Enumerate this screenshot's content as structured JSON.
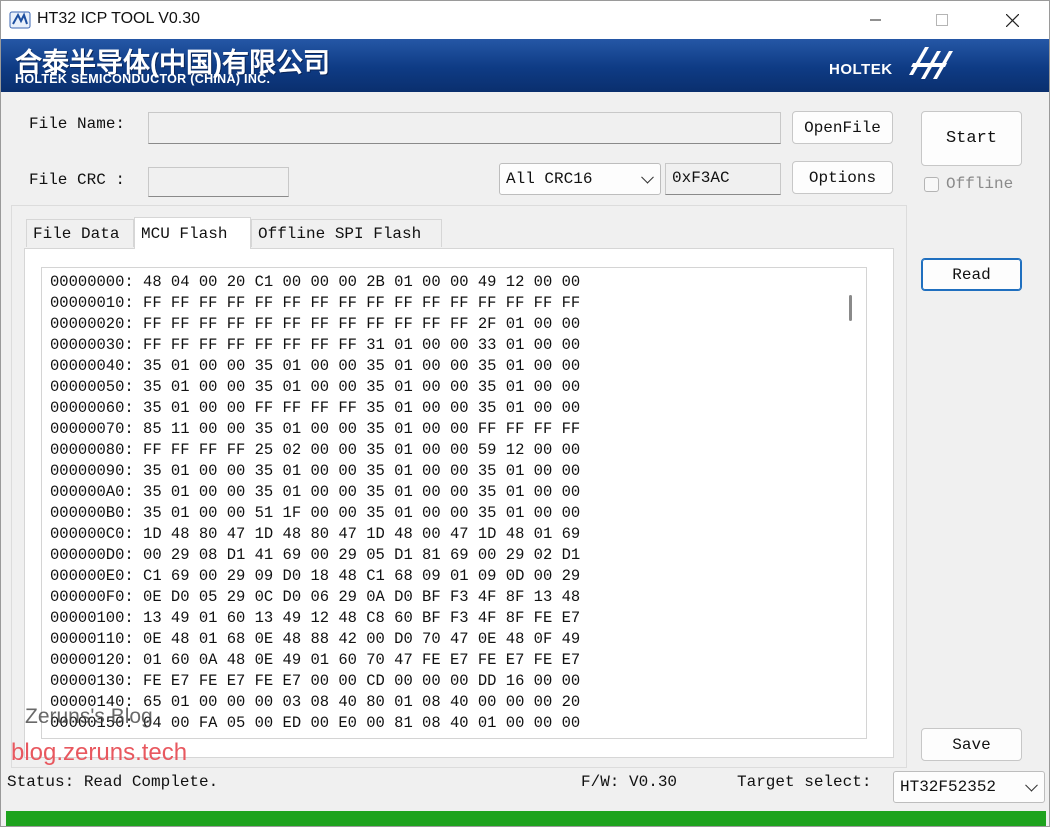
{
  "window": {
    "title": "HT32 ICP TOOL V0.30",
    "minimize_glyph": "—",
    "maximize_glyph": "☐",
    "close_glyph": "✕"
  },
  "banner": {
    "company_cn": "合泰半导体(中国)有限公司",
    "company_en": "HOLTEK SEMICONDUCTOR (CHINA) INC.",
    "brand": "HOLTEK"
  },
  "form": {
    "file_name_label": "File Name:",
    "file_name_value": "",
    "file_crc_label": "File CRC :",
    "file_crc_value": "",
    "crc_mode_selected": "All CRC16",
    "crc_value": "0xF3AC",
    "open_file_label": "OpenFile",
    "options_label": "Options",
    "start_label": "Start",
    "offline_label": "Offline",
    "offline_checked": false
  },
  "tabs": [
    {
      "label": "File Data",
      "active": false
    },
    {
      "label": "MCU Flash",
      "active": true
    },
    {
      "label": "Offline SPI Flash",
      "active": false
    }
  ],
  "hex_lines": [
    "00000000: 48 04 00 20 C1 00 00 00 2B 01 00 00 49 12 00 00",
    "00000010: FF FF FF FF FF FF FF FF FF FF FF FF FF FF FF FF",
    "00000020: FF FF FF FF FF FF FF FF FF FF FF FF 2F 01 00 00",
    "00000030: FF FF FF FF FF FF FF FF 31 01 00 00 33 01 00 00",
    "00000040: 35 01 00 00 35 01 00 00 35 01 00 00 35 01 00 00",
    "00000050: 35 01 00 00 35 01 00 00 35 01 00 00 35 01 00 00",
    "00000060: 35 01 00 00 FF FF FF FF 35 01 00 00 35 01 00 00",
    "00000070: 85 11 00 00 35 01 00 00 35 01 00 00 FF FF FF FF",
    "00000080: FF FF FF FF 25 02 00 00 35 01 00 00 59 12 00 00",
    "00000090: 35 01 00 00 35 01 00 00 35 01 00 00 35 01 00 00",
    "000000A0: 35 01 00 00 35 01 00 00 35 01 00 00 35 01 00 00",
    "000000B0: 35 01 00 00 51 1F 00 00 35 01 00 00 35 01 00 00",
    "000000C0: 1D 48 80 47 1D 48 80 47 1D 48 00 47 1D 48 01 69",
    "000000D0: 00 29 08 D1 41 69 00 29 05 D1 81 69 00 29 02 D1",
    "000000E0: C1 69 00 29 09 D0 18 48 C1 68 09 01 09 0D 00 29",
    "000000F0: 0E D0 05 29 0C D0 06 29 0A D0 BF F3 4F 8F 13 48",
    "00000100: 13 49 01 60 13 49 12 48 C8 60 BF F3 4F 8F FE E7",
    "00000110: 0E 48 01 68 0E 48 88 42 00 D0 70 47 0E 48 0F 49",
    "00000120: 01 60 0A 48 0E 49 01 60 70 47 FE E7 FE E7 FE E7",
    "00000130: FE E7 FE E7 FE E7 00 00 CD 00 00 00 DD 16 00 00",
    "00000140: 65 01 00 00 00 03 08 40 80 01 08 40 00 00 00 20",
    "00000150: 04 00 FA 05 00 ED 00 E0 00 81 08 40 01 00 00 00"
  ],
  "right_panel": {
    "read_label": "Read",
    "save_label": "Save"
  },
  "watermark": {
    "line1": "Zeruns's Blog",
    "line2": "blog.zeruns.tech"
  },
  "status_bar": {
    "status_text": "Status: Read Complete.",
    "fw_text": "F/W: V0.30",
    "target_label": "Target select:",
    "target_selected": "HT32F52352",
    "progress_fraction": 1.0,
    "progress_color": "#1ea31e"
  }
}
